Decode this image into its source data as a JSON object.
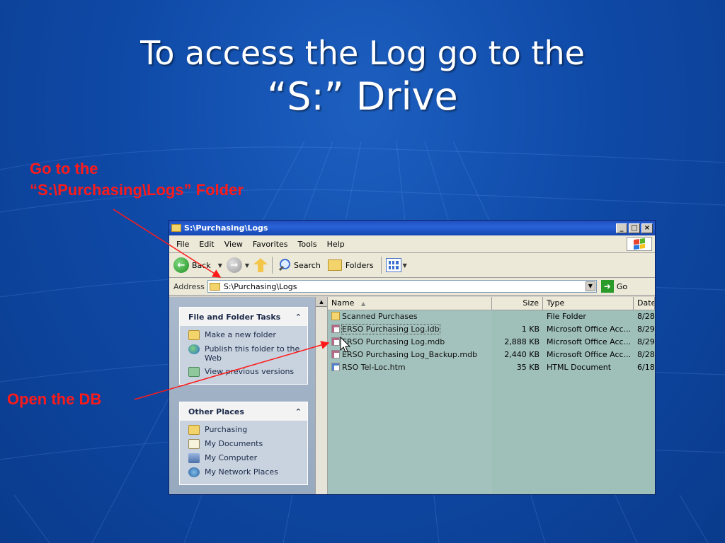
{
  "slide": {
    "title_line1": "To  access the Log go to the",
    "title_line2": "“S:” Drive",
    "annotation_folder_line1": "Go to the",
    "annotation_folder_line2": "“S:\\Purchasing\\Logs” Folder",
    "annotation_db": "Open the DB",
    "annotation_color": "#ff1a1a"
  },
  "window": {
    "title": "S:\\Purchasing\\Logs",
    "buttons": {
      "minimize": "_",
      "maximize": "□",
      "close": "×"
    },
    "menu": [
      "File",
      "Edit",
      "View",
      "Favorites",
      "Tools",
      "Help"
    ],
    "toolbar": {
      "back": "Back",
      "search": "Search",
      "folders": "Folders"
    },
    "address": {
      "label": "Address",
      "value": "S:\\Purchasing\\Logs",
      "go": "Go"
    },
    "tasks": {
      "file_folder_title": "File and Folder Tasks",
      "file_folder_items": [
        {
          "label": "Make a new folder",
          "icon": "new-folder-icon"
        },
        {
          "label": "Publish this folder to the Web",
          "icon": "globe-icon"
        },
        {
          "label": "View previous versions",
          "icon": "history-icon"
        }
      ],
      "other_places_title": "Other Places",
      "other_places_items": [
        {
          "label": "Purchasing",
          "icon": "folder-icon"
        },
        {
          "label": "My Documents",
          "icon": "documents-icon"
        },
        {
          "label": "My Computer",
          "icon": "computer-icon"
        },
        {
          "label": "My Network Places",
          "icon": "network-icon"
        }
      ]
    },
    "columns": {
      "name": "Name",
      "size": "Size",
      "type": "Type",
      "date": "Date"
    },
    "files": [
      {
        "name": "Scanned Purchases",
        "size": "",
        "type": "File Folder",
        "date": "8/28",
        "icon": "folder-icon"
      },
      {
        "name": "ERSO Purchasing Log.ldb",
        "size": "1 KB",
        "type": "Microsoft Office Acc...",
        "date": "8/29",
        "icon": "ldb-icon"
      },
      {
        "name": "ERSO Purchasing Log.mdb",
        "size": "2,888 KB",
        "type": "Microsoft Office Acc...",
        "date": "8/29",
        "icon": "mdb-icon"
      },
      {
        "name": "ERSO Purchasing Log_Backup.mdb",
        "size": "2,440 KB",
        "type": "Microsoft Office Acc...",
        "date": "8/28",
        "icon": "mdb-icon"
      },
      {
        "name": "RSO Tel-Loc.htm",
        "size": "35 KB",
        "type": "HTML Document",
        "date": "6/18",
        "icon": "htm-icon"
      }
    ]
  }
}
